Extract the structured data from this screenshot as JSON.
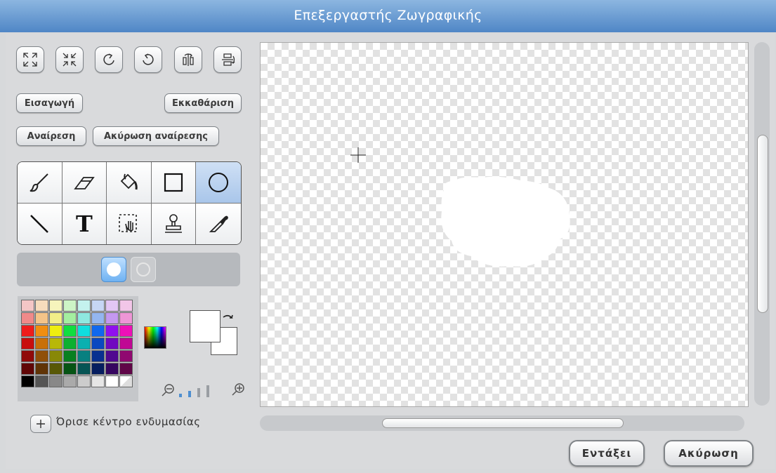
{
  "window": {
    "title": "Επεξεργαστής Ζωγραφικής"
  },
  "toolbar": {
    "icons": [
      "grow-icon",
      "shrink-icon",
      "rotate-left-icon",
      "rotate-right-icon",
      "flip-horizontal-icon",
      "flip-vertical-icon"
    ]
  },
  "buttons": {
    "import": "Εισαγωγή",
    "clear": "Εκκαθάριση",
    "undo": "Αναίρεση",
    "redo": "Ακύρωση αναίρεσης",
    "ok": "Εντάξει",
    "cancel": "Ακύρωση"
  },
  "tools": {
    "items": [
      "paintbrush-icon",
      "eraser-icon",
      "fill-bucket-icon",
      "rectangle-icon",
      "ellipse-icon",
      "line-icon",
      "text-icon",
      "select-icon",
      "stamp-icon",
      "eyedropper-icon"
    ],
    "selected": "ellipse-icon",
    "text_glyph": "T"
  },
  "shape_options": {
    "selected": "filled"
  },
  "colors": {
    "palette": [
      "#f4c6c6",
      "#f6dcbc",
      "#f6f4bc",
      "#cdf4c6",
      "#c4f2ee",
      "#c6d6f4",
      "#e2c6f4",
      "#f2c6e8",
      "#f08a8a",
      "#f4c488",
      "#f2ee88",
      "#a4eea0",
      "#8ee8e0",
      "#94b6f0",
      "#c498f0",
      "#ee96d6",
      "#ee1c1c",
      "#f08e10",
      "#eeee10",
      "#10de40",
      "#10dede",
      "#1068ee",
      "#9010ee",
      "#ee10b8",
      "#c80e0e",
      "#c87008",
      "#b8b808",
      "#0cb030",
      "#0ab0b0",
      "#0a48c0",
      "#7008c0",
      "#c00894",
      "#900a0a",
      "#905008",
      "#888808",
      "#088020",
      "#088080",
      "#083090",
      "#500890",
      "#900870",
      "#600606",
      "#603406",
      "#585806",
      "#065414",
      "#065454",
      "#061e60",
      "#360660",
      "#600648",
      "#000000",
      "#555555",
      "#888888",
      "#aaaaaa",
      "#cccccc",
      "#e6e6e6",
      "#ffffff",
      "#ffffff"
    ],
    "foreground": "#ffffff",
    "background": "#ffffff",
    "accent": "#4f86c6"
  },
  "zoom": {
    "level": 2,
    "max": 4
  },
  "costume_center": {
    "label": "Όρισε κέντρο ενδυμασίας"
  },
  "canvas": {
    "cursor": "crosshair"
  }
}
